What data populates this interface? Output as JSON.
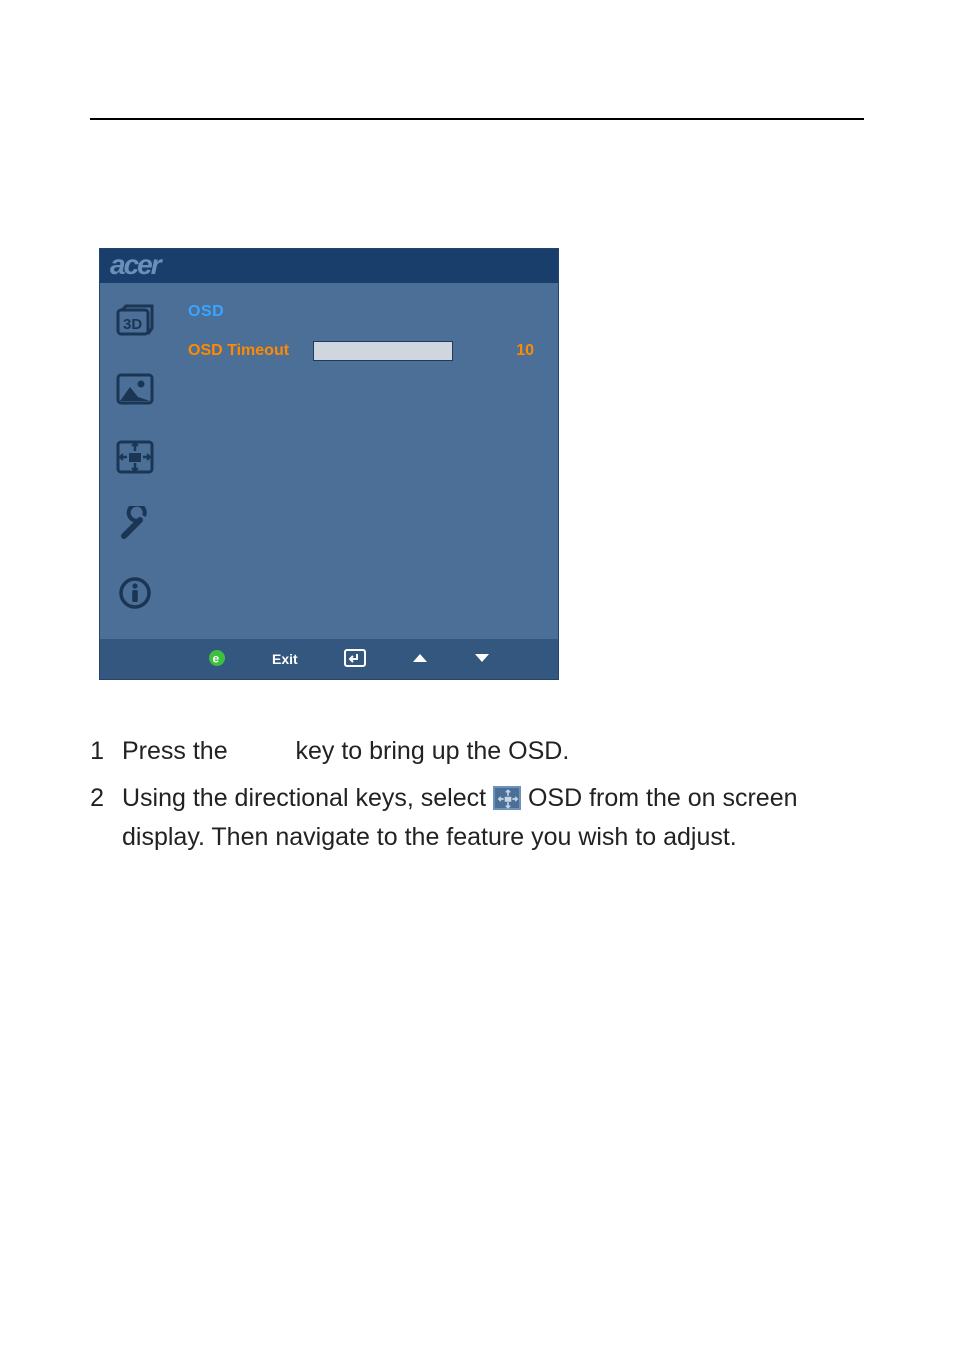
{
  "osd": {
    "brand": "acer",
    "title": "OSD",
    "row_label": "OSD Timeout",
    "row_value": "10",
    "sidebar_icons": [
      "3d-icon",
      "picture-icon",
      "osd-position-icon",
      "settings-icon",
      "info-icon"
    ],
    "footer": {
      "e_icon": "e-green-icon",
      "exit_label": "Exit",
      "enter_icon": "enter-icon",
      "up_icon": "up-arrow-icon",
      "down_icon": "down-arrow-icon"
    }
  },
  "steps": {
    "s1_num": "1",
    "s1_a": "Press the ",
    "s1_b": " key to bring up the OSD.",
    "s2_num": "2",
    "s2_a": "Using the directional keys, select ",
    "s2_b": " OSD from the on screen display. Then navigate to the feature you wish to adjust."
  }
}
